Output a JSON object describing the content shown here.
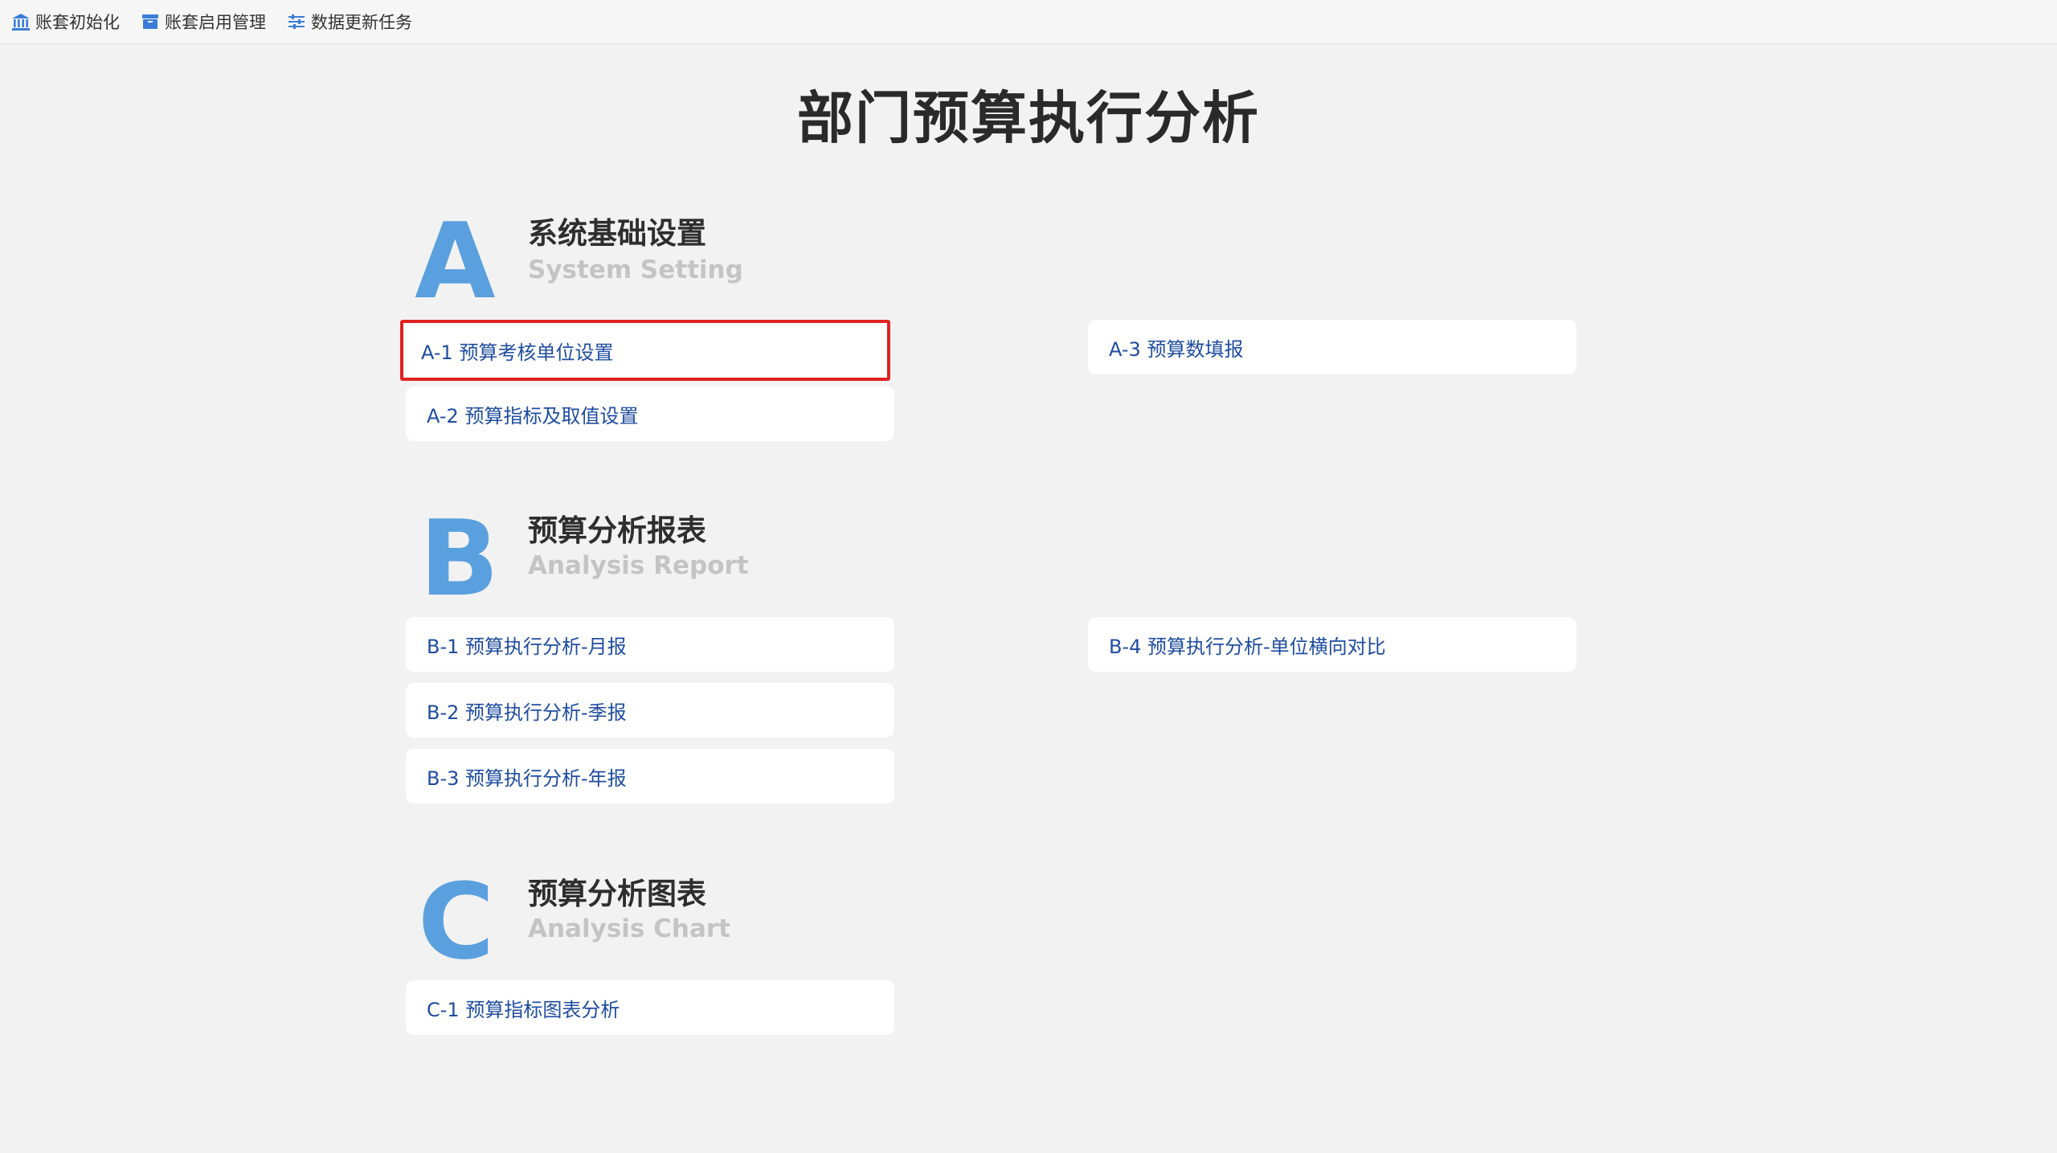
{
  "toolbar": {
    "items": [
      {
        "label": "账套初始化",
        "icon": "bank-icon"
      },
      {
        "label": "账套启用管理",
        "icon": "archive-box-icon"
      },
      {
        "label": "数据更新任务",
        "icon": "sliders-icon"
      }
    ]
  },
  "page": {
    "title": "部门预算执行分析"
  },
  "colors": {
    "accent": "#5aa0df",
    "link": "#1f4da0",
    "highlight": "#e0231f"
  },
  "sections": [
    {
      "letter": "A",
      "title": "系统基础设置",
      "subtitle": "System Setting",
      "items": [
        {
          "label": "A-1 预算考核单位设置",
          "selected": true
        },
        {
          "label": "A-2 预算指标及取值设置"
        },
        {
          "label": "A-3 预算数填报"
        }
      ]
    },
    {
      "letter": "B",
      "title": "预算分析报表",
      "subtitle": "Analysis Report",
      "items": [
        {
          "label": "B-1 预算执行分析-月报"
        },
        {
          "label": "B-2 预算执行分析-季报"
        },
        {
          "label": "B-3 预算执行分析-年报"
        },
        {
          "label": "B-4 预算执行分析-单位横向对比"
        }
      ]
    },
    {
      "letter": "C",
      "title": "预算分析图表",
      "subtitle": "Analysis Chart",
      "items": [
        {
          "label": "C-1 预算指标图表分析"
        }
      ]
    }
  ]
}
